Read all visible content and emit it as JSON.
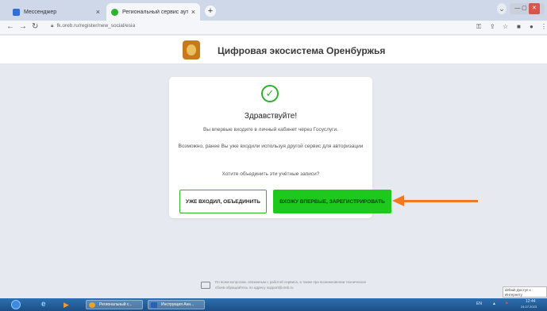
{
  "browser": {
    "tabs": [
      {
        "title": "Мессенджер",
        "close": "×",
        "icon_color": "#2f6fd6"
      },
      {
        "title": "Региональный сервис аутентиф...",
        "close": "×",
        "icon_color": "#2fb32f"
      }
    ],
    "new_tab": "+",
    "url": "fk.oreb.ru/register/new_social/esia"
  },
  "header": {
    "brand_name": "Цифровая экосистема Оренбуржья"
  },
  "modal": {
    "greeting": "Здравствуйте!",
    "first_login_text": "Вы впервые входите в личный кабинет через Госуслуги.",
    "maybe_text": "Возможно, ранее Вы уже входили используя другой сервис для авторизации",
    "question": "Хотите объединить эти учётные записи?",
    "merge_button": "Уже входил, объединить",
    "register_button": "Вхожу впервые, зарегистрировать",
    "check_color": "#2fb32f",
    "register_color": "#1cc91c"
  },
  "annotation": {
    "arrow_color": "#f07a24"
  },
  "footer": {
    "note": "По всем вопросам, связанным с работой сервиса, а также при возникновении технических сбоев обращайтесь по адресу support@oreb.ru"
  },
  "tooltip": {
    "text": "default Доступ к Интернету"
  },
  "taskbar": {
    "apps": [
      "Региональный с...",
      "Инструкция Анн..."
    ],
    "lang": "EN",
    "clock_time": "12:44",
    "clock_date": "24.07.2023"
  }
}
